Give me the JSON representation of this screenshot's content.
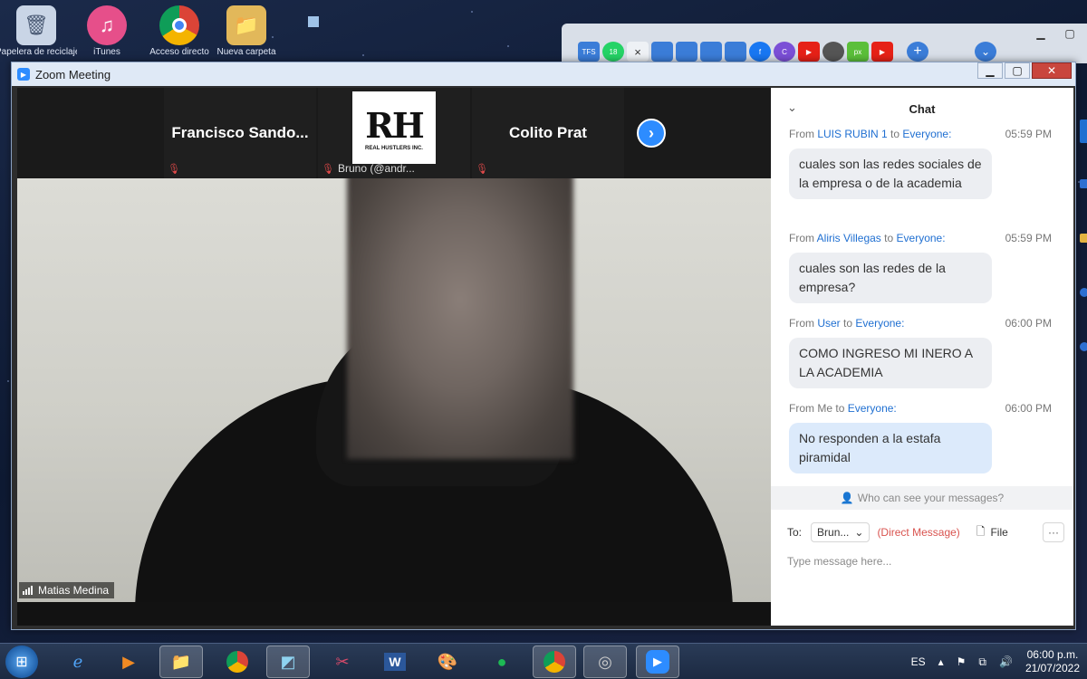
{
  "desktop": {
    "icons": [
      {
        "label": "Papelera de reciclaje",
        "icon": "recycle-bin-icon",
        "color": "#c9d5e6"
      },
      {
        "label": "iTunes",
        "icon": "itunes-icon",
        "color": "#e64f8a"
      },
      {
        "label": "Acceso directo",
        "icon": "chrome-icon",
        "color": "#2f9d4f"
      },
      {
        "label": "Nueva carpeta",
        "icon": "folder-icon",
        "color": "#e2b85a"
      }
    ]
  },
  "browser": {
    "tabs": [
      "TFS",
      "18",
      "×",
      "",
      "",
      "",
      "",
      "f",
      "C",
      "▶",
      "",
      "px",
      "▶"
    ],
    "new_tab": "+",
    "list_tabs": "⌄"
  },
  "zoom": {
    "window_title": "Zoom Meeting",
    "gallery": [
      {
        "name": "",
        "sub": ""
      },
      {
        "name": "Francisco  Sando...",
        "sub": ""
      },
      {
        "name": "",
        "sub": "Bruno (@andr..."
      },
      {
        "name": "Colito Prat",
        "sub": ""
      }
    ],
    "logo_letters": "RH",
    "logo_tagline": "REAL HUSTLERS INC.",
    "speaker": "Matias Medina",
    "chat": {
      "title": "Chat",
      "messages": [
        {
          "from": "LUIS RUBIN 1",
          "to": "Everyone:",
          "time": "05:59 PM",
          "text": "cuales son las redes sociales de la empresa o de la academia",
          "mine": false
        },
        {
          "from": "Aliris Villegas",
          "to": "Everyone:",
          "time": "05:59 PM",
          "text": "cuales son las redes de la empresa?",
          "mine": false
        },
        {
          "from": "User",
          "to": "Everyone:",
          "time": "06:00 PM",
          "text": "COMO INGRESO MI INERO A LA ACADEMIA",
          "mine": false
        },
        {
          "from": "Me",
          "to": "Everyone:",
          "time": "06:00 PM",
          "text": "No responden a la estafa piramidal",
          "mine": true
        }
      ],
      "from_label": "From",
      "to_label": "to",
      "who_can_see": "Who can see your messages?",
      "to_prefix": "To:",
      "recipient": "Brun...",
      "direct_message": "(Direct Message)",
      "file_label": "File",
      "more": "···",
      "input_placeholder": "Type message here..."
    }
  },
  "taskbar": {
    "language": "ES",
    "time": "06:00 p.m.",
    "date": "21/07/2022"
  },
  "colors": {
    "zoom_blue": "#2d8cff",
    "link_blue": "#1f6fd1",
    "dm_red": "#d9534f"
  }
}
